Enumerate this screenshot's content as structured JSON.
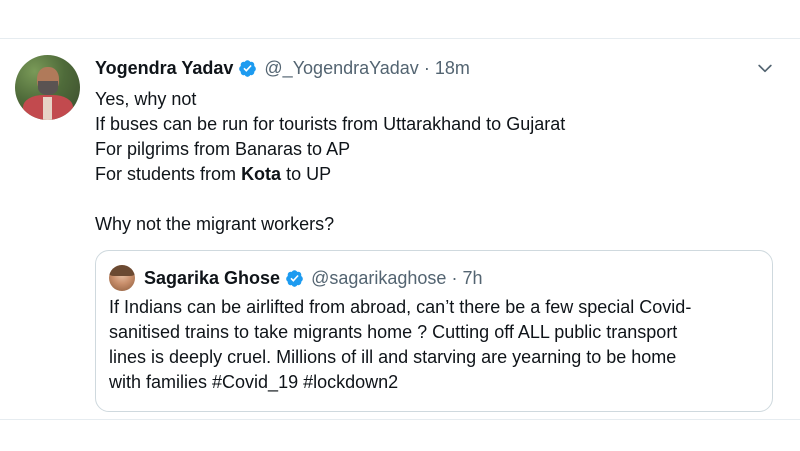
{
  "tweet": {
    "author_name": "Yogendra Yadav",
    "handle": "@_YogendraYadav",
    "separator": "·",
    "time": "18m",
    "lines": [
      "Yes, why not",
      "If buses can be run for tourists from Uttarakhand to Gujarat",
      "For pilgrims from Banaras to AP"
    ],
    "line4_prefix": "For students from ",
    "line4_bold": "Kota",
    "line4_suffix": " to UP",
    "line5": "Why not the migrant workers?"
  },
  "quote": {
    "author_name": "Sagarika Ghose",
    "handle": "@sagarikaghose",
    "separator": "·",
    "time": "7h",
    "lines": [
      "If Indians can be airlifted from abroad, can’t there be a few special Covid-",
      "sanitised trains to take migrants home ? Cutting off ALL public transport",
      "lines is deeply cruel. Millions of ill and starving are yearning to be home",
      "with families #Covid_19 #lockdown2"
    ]
  },
  "icons": {
    "verified": "verified-badge-icon",
    "more": "chevron-down-icon"
  },
  "colors": {
    "verified_blue": "#1d9bf0",
    "text": "#0f1419",
    "secondary": "#536471",
    "border": "#cfd9de"
  }
}
